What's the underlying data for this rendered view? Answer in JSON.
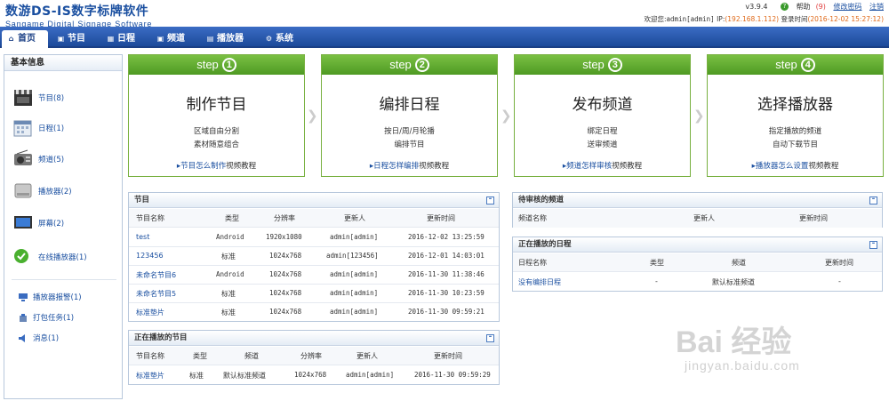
{
  "header": {
    "logo_main": "数游DS-IS数字标牌软件",
    "logo_sub": "Sangame Digital Signage Software",
    "version": "v3.9.4",
    "help_label": "帮助",
    "help_count": "(9)",
    "change_password": "修改密码",
    "logout": "注销",
    "welcome_prefix": "欢迎您:",
    "user": "admin[admin]",
    "ip_label": "IP:",
    "ip": "(192.168.1.112)",
    "login_time_label": "登录时间",
    "login_time": "(2016-12-02 15:27:12)"
  },
  "nav": {
    "tabs": [
      {
        "label": "首页",
        "icon": "home-icon"
      },
      {
        "label": "节目",
        "icon": "film-icon"
      },
      {
        "label": "日程",
        "icon": "grid-icon"
      },
      {
        "label": "频道",
        "icon": "radio-icon"
      },
      {
        "label": "播放器",
        "icon": "monitor-icon"
      },
      {
        "label": "系统",
        "icon": "gears-icon"
      }
    ]
  },
  "sidebar": {
    "title": "基本信息",
    "items": [
      {
        "label": "节目(8)",
        "icon": "film-clapper-icon"
      },
      {
        "label": "日程(1)",
        "icon": "calendar-icon"
      },
      {
        "label": "频道(5)",
        "icon": "radio-icon"
      },
      {
        "label": "播放器(2)",
        "icon": "player-box-icon"
      },
      {
        "label": "屏幕(2)",
        "icon": "screen-icon"
      },
      {
        "label": "在线播放器(1)",
        "icon": "check-circle-icon"
      }
    ],
    "small_items": [
      {
        "label": "播放器报警(1)",
        "icon": "alarm-icon"
      },
      {
        "label": "打包任务(1)",
        "icon": "package-icon"
      },
      {
        "label": "消息(1)",
        "icon": "speaker-icon"
      }
    ]
  },
  "steps": [
    {
      "step": "step",
      "num": "1",
      "title": "制作节目",
      "desc1": "区域自由分割",
      "desc2": "素材随意组合",
      "link": "节目怎么制作",
      "link_suffix": "视频教程"
    },
    {
      "step": "step",
      "num": "2",
      "title": "编排日程",
      "desc1": "按日/周/月轮播",
      "desc2": "编排节目",
      "link": "日程怎样编排",
      "link_suffix": "视频教程"
    },
    {
      "step": "step",
      "num": "3",
      "title": "发布频道",
      "desc1": "绑定日程",
      "desc2": "送审频道",
      "link": "频道怎样审核",
      "link_suffix": "视频教程"
    },
    {
      "step": "step",
      "num": "4",
      "title": "选择播放器",
      "desc1": "指定播放的频道",
      "desc2": "自动下载节目",
      "link": "播放器怎么设置",
      "link_suffix": "视频教程"
    }
  ],
  "programs": {
    "title": "节目",
    "columns": [
      "节目名称",
      "类型",
      "分辨率",
      "更新人",
      "更新时间"
    ],
    "rows": [
      [
        "test",
        "Android",
        "1920x1080",
        "admin[admin]",
        "2016-12-02 13:25:59"
      ],
      [
        "123456",
        "标准",
        "1024x768",
        "admin[123456]",
        "2016-12-01 14:03:01"
      ],
      [
        "未命名节目6",
        "Android",
        "1024x768",
        "admin[admin]",
        "2016-11-30 11:38:46"
      ],
      [
        "未命名节目5",
        "标准",
        "1024x768",
        "admin[admin]",
        "2016-11-30 10:23:59"
      ],
      [
        "标准垫片",
        "标准",
        "1024x768",
        "admin[admin]",
        "2016-11-30 09:59:21"
      ]
    ]
  },
  "playing_programs": {
    "title": "正在播放的节目",
    "columns": [
      "节目名称",
      "类型",
      "频道",
      "分辨率",
      "更新人",
      "更新时间"
    ],
    "rows": [
      [
        "标准垫片",
        "标准",
        "默认标准频道",
        "1024x768",
        "admin[admin]",
        "2016-11-30 09:59:29"
      ]
    ]
  },
  "pending_channels": {
    "title": "待审核的频道",
    "columns": [
      "频道名称",
      "更新人",
      "更新时间"
    ]
  },
  "playing_schedules": {
    "title": "正在播放的日程",
    "columns": [
      "日程名称",
      "类型",
      "频道",
      "更新时间"
    ],
    "rows": [
      [
        "没有编排日程",
        "-",
        "默认标准频道",
        "-"
      ]
    ]
  },
  "watermark": {
    "main": "Bai 经验",
    "sub": "jingyan.baidu.com"
  },
  "colors": {
    "nav": "#1c4a9a",
    "step_green": "#5aa82e",
    "link": "#1a4fa0",
    "orange": "#e06a1a"
  }
}
